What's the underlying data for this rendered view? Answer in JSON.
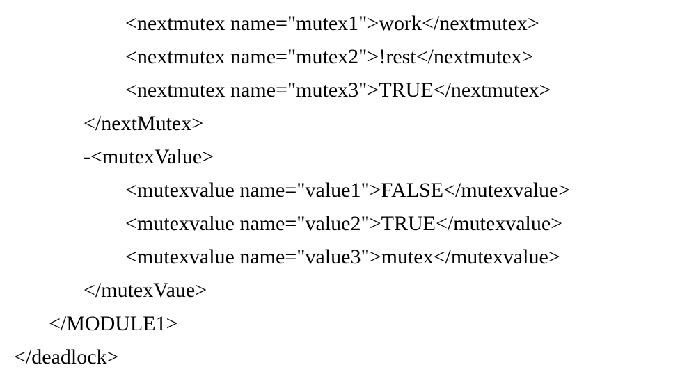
{
  "lines": [
    {
      "indent": 3,
      "text": "<nextmutex name=\"mutex1\">work</nextmutex>"
    },
    {
      "indent": 3,
      "text": "<nextmutex name=\"mutex2\">!rest</nextmutex>"
    },
    {
      "indent": 3,
      "text": "<nextmutex name=\"mutex3\">TRUE</nextmutex>"
    },
    {
      "indent": 2,
      "text": "</nextMutex>"
    },
    {
      "indent": 2,
      "text": "-<mutexValue>"
    },
    {
      "indent": 3,
      "text": "<mutexvalue name=\"value1\">FALSE</mutexvalue>"
    },
    {
      "indent": 3,
      "text": "<mutexvalue name=\"value2\">TRUE</mutexvalue>"
    },
    {
      "indent": 3,
      "text": "<mutexvalue name=\"value3\">mutex</mutexvalue>"
    },
    {
      "indent": 2,
      "text": "</mutexVaue>"
    },
    {
      "indent": 1,
      "text": "</MODULE1>"
    },
    {
      "indent": 0,
      "text": "</deadlock>"
    }
  ]
}
